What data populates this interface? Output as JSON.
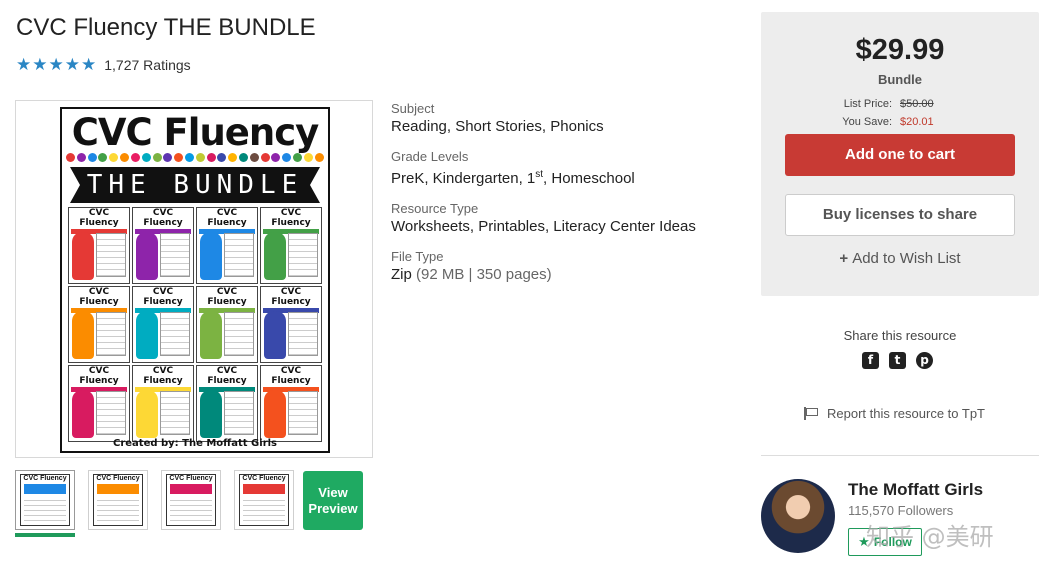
{
  "product": {
    "title": "CVC Fluency THE BUNDLE",
    "rating_count": "1,727 Ratings",
    "star_count": 5
  },
  "cover": {
    "title": "CVC Fluency",
    "banner": "THE BUNDLE",
    "tile_title": "CVC Fluency",
    "created_by": "Created by: The Moffatt Girls",
    "dot_colors": [
      "#e53935",
      "#8e24aa",
      "#1e88e5",
      "#43a047",
      "#fdd835",
      "#fb8c00",
      "#e91e63",
      "#00acc1",
      "#7cb342",
      "#5e35b1",
      "#f4511e",
      "#039be5",
      "#c0ca33",
      "#d81b60",
      "#3949ab",
      "#ffb300",
      "#00897b",
      "#6d4c41",
      "#e53935",
      "#8e24aa",
      "#1e88e5",
      "#43a047",
      "#fdd835",
      "#fb8c00"
    ],
    "tile_colors": [
      "#e53935",
      "#8e24aa",
      "#1e88e5",
      "#43a047",
      "#fb8c00",
      "#00acc1",
      "#7cb342",
      "#3949ab",
      "#d81b60",
      "#fdd835",
      "#00897b",
      "#f4511e"
    ]
  },
  "thumbnails": [
    {
      "label": "CVC Fluency",
      "color": "#1e88e5"
    },
    {
      "label": "CVC Fluency",
      "color": "#fb8c00"
    },
    {
      "label": "CVC Fluency",
      "color": "#d81b60"
    },
    {
      "label": "CVC Fluency",
      "color": "#e53935"
    }
  ],
  "preview": {
    "label_line1": "View",
    "label_line2": "Preview"
  },
  "meta": {
    "subject_label": "Subject",
    "subject_value": "Reading, Short Stories, Phonics",
    "grade_label": "Grade Levels",
    "grade_value_a": "PreK, Kindergarten, 1",
    "grade_value_sup": "st",
    "grade_value_b": ", Homeschool",
    "resource_label": "Resource Type",
    "resource_value": "Worksheets, Printables, Literacy Center Ideas",
    "file_label": "File Type",
    "file_value": "Zip",
    "file_details": " (92 MB | 350 pages)"
  },
  "buy": {
    "price": "$29.99",
    "price_type": "Bundle",
    "list_price_label": "List Price:",
    "list_price": "$50.00",
    "save_label": "You Save:",
    "save_value": "$20.01",
    "cart_label": "Add one to cart",
    "license_label": "Buy licenses to share",
    "wish_plus": "+",
    "wish_label": "Add to Wish List"
  },
  "share": {
    "label": "Share this resource",
    "icons": [
      "facebook-icon",
      "twitter-icon",
      "pinterest-icon"
    ]
  },
  "report": {
    "label": "Report this resource to TpT"
  },
  "seller": {
    "name": "The Moffatt Girls",
    "followers": "115,570 Followers",
    "follow_label": "Follow",
    "watermark": "知乎 @美研"
  },
  "colors": {
    "accent_green": "#1faa62",
    "cart_red": "#c83a34",
    "star_blue": "#2a86c4"
  }
}
